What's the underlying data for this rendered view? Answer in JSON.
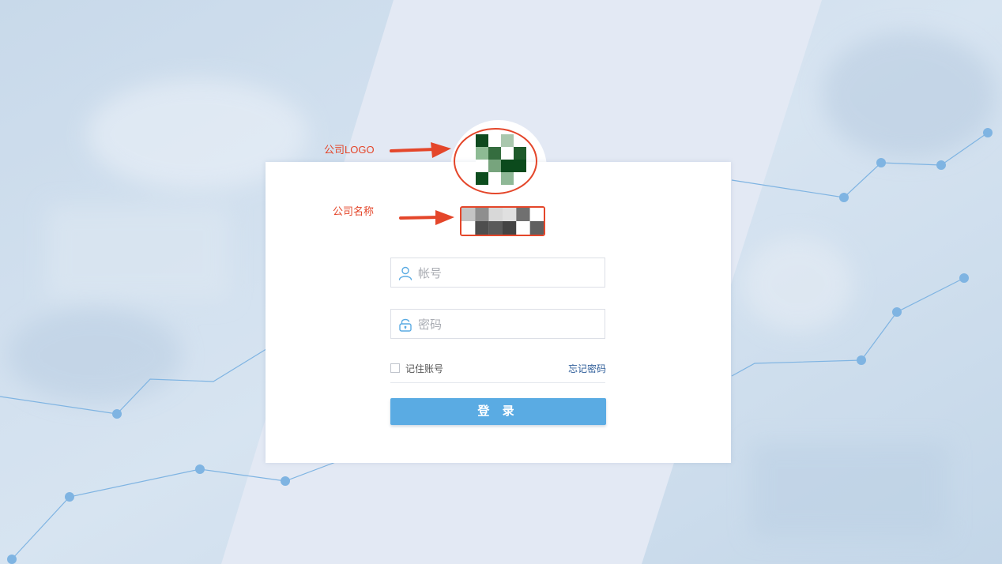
{
  "annotations": {
    "logo_label": "公司LOGO",
    "name_label": "公司名称"
  },
  "login": {
    "username_placeholder": "帐号",
    "password_placeholder": "密码",
    "remember_label": "记住账号",
    "remember_checked": false,
    "forgot_label": "忘记密码",
    "submit_label": "登 录"
  },
  "colors": {
    "accent": "#5aabe3",
    "annotation": "#e4462a",
    "link": "#2f5e9a"
  },
  "icons": {
    "username": "user-icon",
    "password": "lock-icon",
    "annotation_pointer": "arrow-right-icon"
  }
}
